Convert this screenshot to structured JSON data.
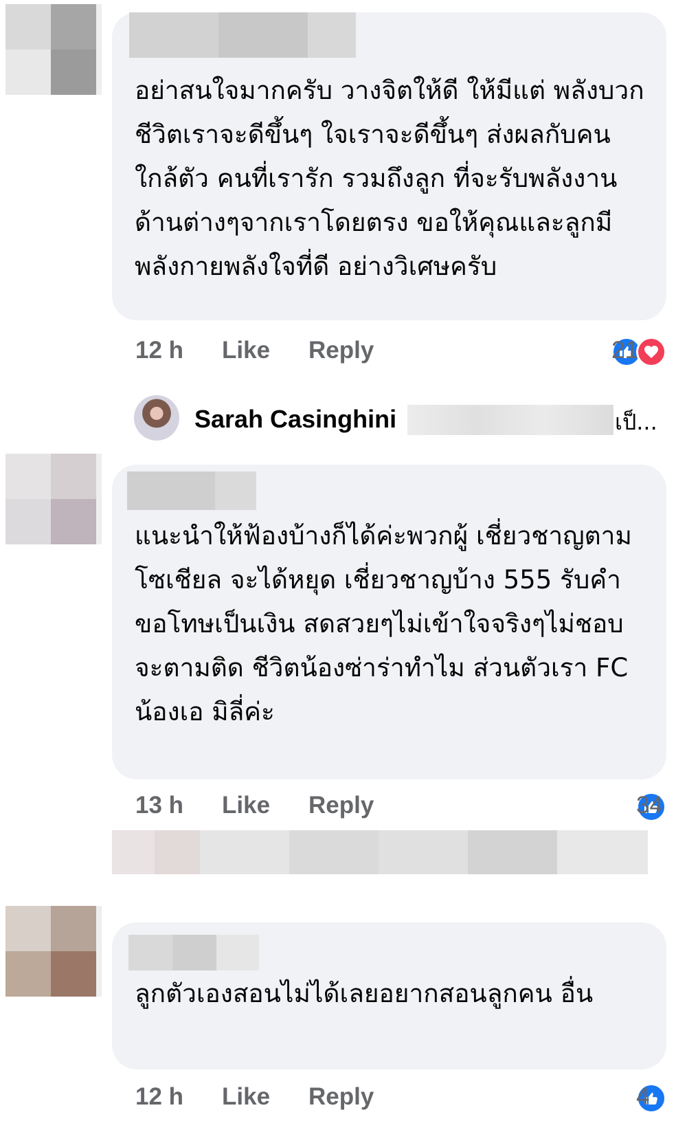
{
  "comments": [
    {
      "text": "อย่าสนใจมากครับ วางจิตให้ดี ให้มีแต่ พลังบวก ชีวิตเราจะดีขึ้นๆ ใจเราจะดีขึ้นๆ ส่งผลกับคนใกล้ตัว คนที่เรารัก รวมถึงลูก ที่จะรับพลังงานด้านต่างๆจากเราโดยตรง ขอให้คุณและลูกมีพลังกายพลังใจที่ดี อย่างวิเศษครับ",
      "time": "12 h",
      "like_label": "Like",
      "reply_label": "Reply",
      "reaction_count": "21",
      "reactions": [
        "like-icon",
        "love-icon"
      ]
    },
    {
      "text": "แนะนำให้ฟ้องบ้างก็ได้ค่ะพวกผู้ เชี่ยวชาญตามโซเชียล จะได้หยุด เชี่ยวชาญบ้าง 555 รับคำขอโทษเป็นเงิน สดสวยๆไม่เข้าใจจริงๆไม่ชอบจะตามติด ชีวิตน้องซ่าร่าทำไม ส่วนตัวเรา FC น้องเอ มิลี่ค่ะ",
      "time": "13 h",
      "like_label": "Like",
      "reply_label": "Reply",
      "reaction_count": "34",
      "reactions": [
        "like-icon"
      ]
    },
    {
      "text": "ลูกตัวเองสอนไม่ได้เลยอยากสอนลูกคน อื่น",
      "time": "12 h",
      "like_label": "Like",
      "reply_label": "Reply",
      "reaction_count": "4",
      "reactions": [
        "like-icon"
      ]
    }
  ],
  "reply_preview": {
    "author": "Sarah Casinghini",
    "tail": "เป็..."
  },
  "colors": {
    "bubble": "#f0f2f5",
    "meta_text": "#65676b",
    "like": "#1877f2",
    "love": "#f33e58"
  }
}
